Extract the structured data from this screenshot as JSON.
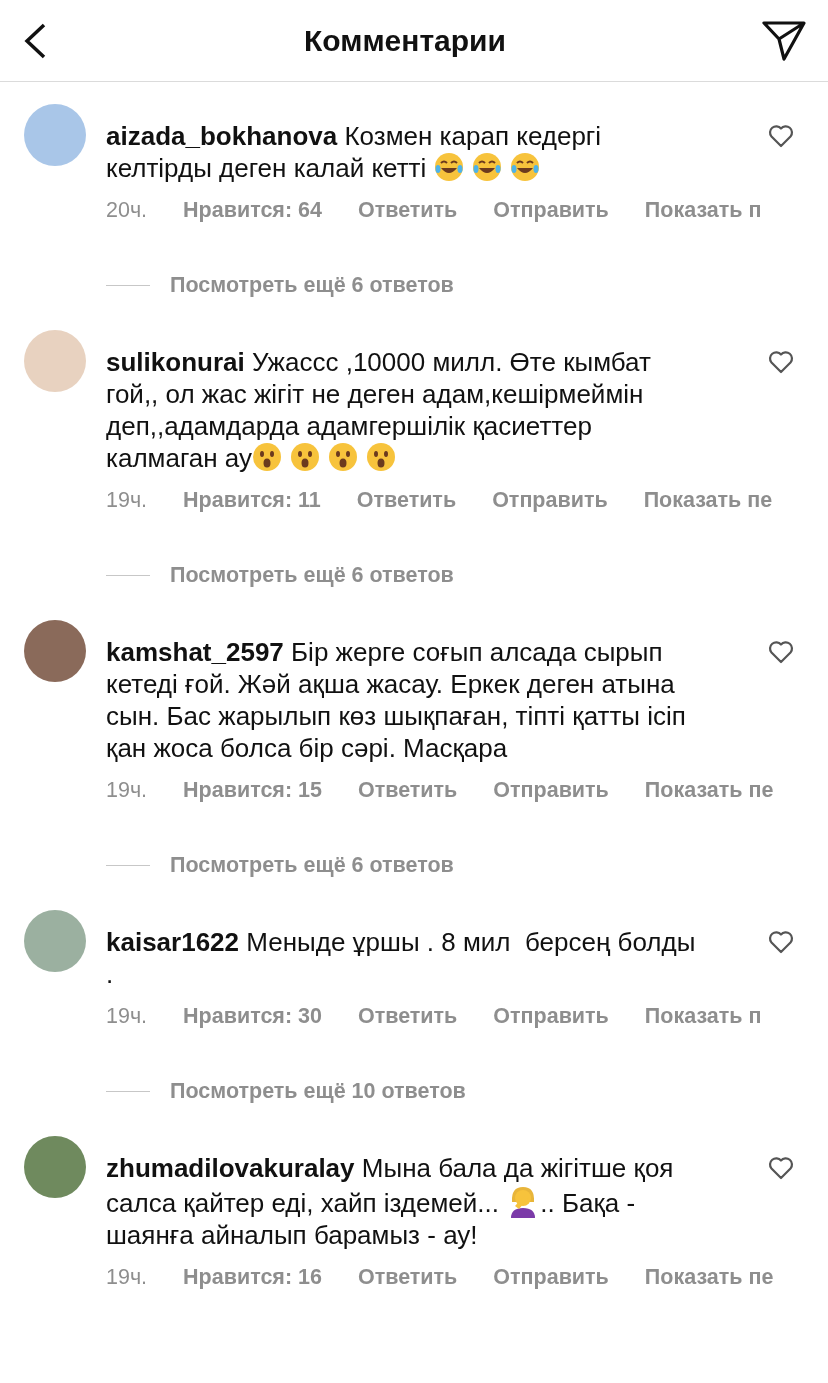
{
  "header": {
    "title": "Комментарии"
  },
  "comments": [
    {
      "username": "aizada_bokhanova",
      "parts": [
        {
          "kind": "text",
          "text": "Козмен карап кедергі келтірды деген калай кетті "
        },
        {
          "kind": "laugh"
        },
        {
          "kind": "laugh"
        },
        {
          "kind": "laugh"
        }
      ],
      "time": "20ч.",
      "likes": "Нравится: 64",
      "reply": "Ответить",
      "send": "Отправить",
      "more": "Показать п",
      "view_replies": "Посмотреть ещё 6 ответов"
    },
    {
      "username": "sulikonurai",
      "parts": [
        {
          "kind": "text",
          "text": "Ужассс ,10000 милл. Өте кымбат гой,, ол жас жігіт не деген адам,кешірмеймін деп,,адамдарда адамгершілік қасиеттер калмаган ау"
        },
        {
          "kind": "wow"
        },
        {
          "kind": "wow"
        },
        {
          "kind": "wow"
        },
        {
          "kind": "wow"
        }
      ],
      "time": "19ч.",
      "likes": "Нравится: 11",
      "reply": "Ответить",
      "send": "Отправить",
      "more": "Показать пе",
      "view_replies": "Посмотреть ещё 6 ответов"
    },
    {
      "username": "kamshat_2597",
      "parts": [
        {
          "kind": "text",
          "text": "Бір жерге соғып алсада сырып кетеді ғой. Жәй ақша жасау. Еркек деген атына сын. Бас жарылып көз шықпаған, тіпті қатты ісіп қан жоса болса бір сәрі. Масқара"
        }
      ],
      "time": "19ч.",
      "likes": "Нравится: 15",
      "reply": "Ответить",
      "send": "Отправить",
      "more": "Показать пе",
      "view_replies": "Посмотреть ещё 6 ответов"
    },
    {
      "username": "kaisar1622",
      "parts": [
        {
          "kind": "text",
          "text": "Меныде ұршы . 8 мил  берсең болды ."
        }
      ],
      "time": "19ч.",
      "likes": "Нравится: 30",
      "reply": "Ответить",
      "send": "Отправить",
      "more": "Показать п",
      "view_replies": "Посмотреть ещё 10 ответов"
    },
    {
      "username": "zhumadilovakuralay",
      "parts": [
        {
          "kind": "text",
          "text": "Мына бала да жігітше қоя салса қайтер еді, хайп іздемей... "
        },
        {
          "kind": "facepalm"
        },
        {
          "kind": "text",
          "text": ".. Бақа - шаянға айналып барамыз - ау!"
        }
      ],
      "time": "19ч.",
      "likes": "Нравится: 16",
      "reply": "Ответить",
      "send": "Отправить",
      "more": "Показать пе"
    }
  ]
}
